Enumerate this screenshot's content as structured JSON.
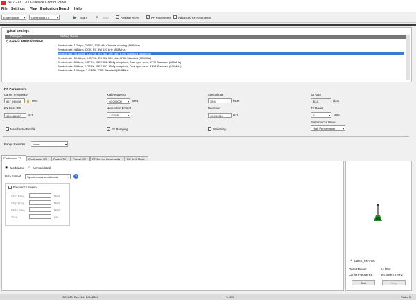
{
  "window": {
    "title": "2407 - CC1200 - Device Control Panel"
  },
  "menu": [
    "File",
    "Settings",
    "View",
    "Evaluation Board",
    "Help"
  ],
  "toolbar": {
    "mode": "Expert Mode",
    "tx_mode": "Continuous TX",
    "start": "Start",
    "stop": "Stop",
    "register_view": "Register View",
    "rf_parameters": "RF Parameters",
    "advanced_rf_parameters": "Advanced RF Parameters"
  },
  "typical": {
    "title": "Typical Settings",
    "col_category": "Category",
    "col_setting": "Setting Name",
    "group": "Generic 868/915/920MHz",
    "rows": [
      "Symbol rate: 1.2kbps, 2-FSK, 12.5 kHz Channel spacing (868MHz)",
      "Symbol rate: 4.8kbps, OOK, RX BW 120 kHz (868MHz)",
      "Symbol rate: 38.4kbps, 2-GFSK, RX BW 100 kHz, ETSI Standard (868MHz)",
      "Symbol rate: 50.4kbps, 2-GFSK, RX BW 100 kHz, ARIB Standard (920MHz)",
      "Symbol rate: 50kbps, 2-GFSK, IEEE 802.15.4g compliant, Dual sync word, ETSI Standard (868MHz)",
      "Symbol rate: 50kbps, 2-GFSK, IEEE 802.15.4g compliant, Dual sync word, ARIB Standard (920MHz)",
      "Symbol rate: 100kbps, 2-GFSK, ETSI Standard (868MHz)"
    ]
  },
  "rf": {
    "title": "RF Parameters",
    "carrier_label": "Carrier Frequency",
    "carrier_value": "867.999878",
    "carrier_unit": "MHz",
    "xtal_label": "Xtal Frequency",
    "xtal_value": "40.000000",
    "xtal_unit": "MHz",
    "symrate_label": "Symbol rate",
    "symrate_value": "38.4",
    "symrate_unit": "ksps",
    "bitrate_label": "Bit Rate",
    "bitrate_value": "38.4",
    "bitrate_unit": "kbps",
    "rxbw_label": "RX Filter BW",
    "rxbw_value": "104.166667",
    "rxbw_unit": "kHz",
    "mod_label": "Modulation Format",
    "mod_value": "2-GFSK",
    "dev_label": "Deviation",
    "dev_value": "19.989014",
    "dev_unit": "kHz",
    "txpower_label": "TX Power",
    "txpower_value": "14",
    "txpower_unit": "dBm",
    "perf_label": "Performance Mode",
    "perf_value": "High Performance",
    "manchester": "Manchester Enable",
    "fk_ramping": "FK Ramping",
    "whitening": "Whitening",
    "range_label": "Range Extender",
    "range_value": "None"
  },
  "tabs": [
    "Continuous TX",
    "Continuous RX",
    "Packet TX",
    "Packet RX",
    "RF Device Commands",
    "RX Sniff Mode"
  ],
  "ctx": {
    "modulated": "Modulated",
    "unmodulated": "Unmodulated",
    "data_format_label": "Data Format",
    "data_format_value": "Synchronous serial mode",
    "info": "?",
    "freq_sweep": "Frequency Sweep",
    "start_freq": "Start Freq.",
    "stop_freq": "Stop Freq.",
    "delta_freq": "Delta Freq.",
    "time": "Time",
    "mhz": "MHz",
    "ms": "ms"
  },
  "right": {
    "lock_status": "LOCK_STATUS",
    "output_power_label": "Output Power:",
    "output_power_value": "14 dBm",
    "carrier_freq_label": "Carrier Frequency:",
    "carrier_freq_value": "867.999878 MHz",
    "start": "Start",
    "stop": "Stop"
  },
  "statusbar": {
    "device": "CC1200, Rev. 1.1, DID=2407",
    "link": "TrxEB",
    "radio": "Radio St"
  }
}
